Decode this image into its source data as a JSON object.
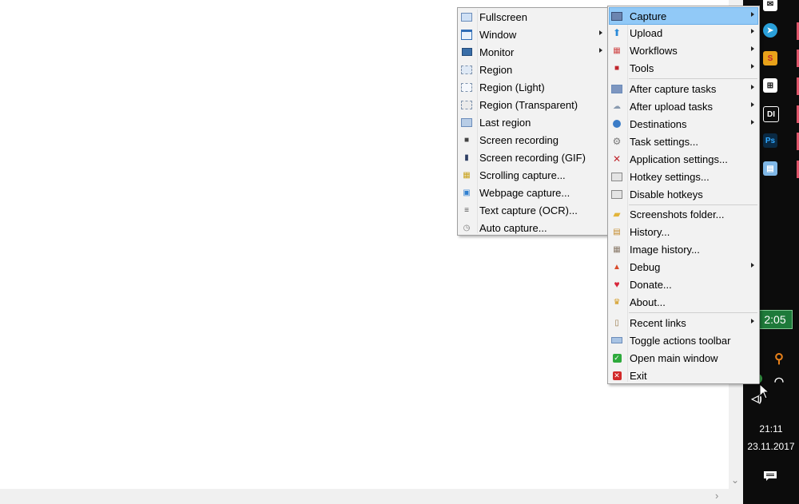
{
  "main_menu": {
    "items": [
      {
        "label": "Capture",
        "icon": "camera-icon",
        "submenu": true
      },
      {
        "label": "Upload",
        "icon": "upload-arrow-icon",
        "submenu": true
      },
      {
        "label": "Workflows",
        "icon": "grid-icon",
        "submenu": true
      },
      {
        "label": "Tools",
        "icon": "toolbox-icon",
        "submenu": true
      },
      {
        "label": "After capture tasks",
        "icon": "capture-tasks-icon",
        "submenu": true
      },
      {
        "label": "After upload tasks",
        "icon": "cloud-icon",
        "submenu": true
      },
      {
        "label": "Destinations",
        "icon": "globe-icon",
        "submenu": true
      },
      {
        "label": "Task settings...",
        "icon": "gear-icon",
        "submenu": false
      },
      {
        "label": "Application settings...",
        "icon": "wrench-icon",
        "submenu": false
      },
      {
        "label": "Hotkey settings...",
        "icon": "keyboard-icon",
        "submenu": false
      },
      {
        "label": "Disable hotkeys",
        "icon": "keyboard-disabled-icon",
        "submenu": false
      },
      {
        "label": "Screenshots folder...",
        "icon": "folder-icon",
        "submenu": false
      },
      {
        "label": "History...",
        "icon": "history-icon",
        "submenu": false
      },
      {
        "label": "Image history...",
        "icon": "image-history-icon",
        "submenu": false
      },
      {
        "label": "Debug",
        "icon": "traffic-cone-icon",
        "submenu": true
      },
      {
        "label": "Donate...",
        "icon": "heart-icon",
        "submenu": false
      },
      {
        "label": "About...",
        "icon": "crown-icon",
        "submenu": false
      },
      {
        "label": "Recent links",
        "icon": "clipboard-icon",
        "submenu": true
      },
      {
        "label": "Toggle actions toolbar",
        "icon": "toolbar-icon",
        "submenu": false
      },
      {
        "label": "Open main window",
        "icon": "check-icon",
        "submenu": false
      },
      {
        "label": "Exit",
        "icon": "exit-icon",
        "submenu": false
      }
    ]
  },
  "capture_submenu": {
    "items": [
      {
        "label": "Fullscreen",
        "icon": "fullscreen-icon",
        "submenu": false
      },
      {
        "label": "Window",
        "icon": "window-icon",
        "submenu": true
      },
      {
        "label": "Monitor",
        "icon": "monitor-icon",
        "submenu": true
      },
      {
        "label": "Region",
        "icon": "region-icon",
        "submenu": false
      },
      {
        "label": "Region (Light)",
        "icon": "region-light-icon",
        "submenu": false
      },
      {
        "label": "Region (Transparent)",
        "icon": "region-transparent-icon",
        "submenu": false
      },
      {
        "label": "Last region",
        "icon": "last-region-icon",
        "submenu": false
      },
      {
        "label": "Screen recording",
        "icon": "video-camera-icon",
        "submenu": false
      },
      {
        "label": "Screen recording (GIF)",
        "icon": "film-icon",
        "submenu": false
      },
      {
        "label": "Scrolling capture...",
        "icon": "scroll-icon",
        "submenu": false
      },
      {
        "label": "Webpage capture...",
        "icon": "webpage-icon",
        "submenu": false
      },
      {
        "label": "Text capture (OCR)...",
        "icon": "text-ocr-icon",
        "submenu": false
      },
      {
        "label": "Auto capture...",
        "icon": "clock-icon",
        "submenu": false
      }
    ]
  },
  "taskbar": {
    "tray_clock_badge": "2:05",
    "time": "21:11",
    "date": "23.11.2017",
    "icons": [
      "mail-icon",
      "telegram-icon",
      "skype-icon",
      "store-icon",
      "di-icon",
      "photoshop-icon",
      "notebook-icon"
    ]
  },
  "colors": {
    "highlight": "#91c9f7",
    "menu_bg": "#f2f2f2",
    "taskbar_bg": "#0c0c0c",
    "badge_green": "#1e7a3a",
    "accent_red": "#e0556a"
  }
}
